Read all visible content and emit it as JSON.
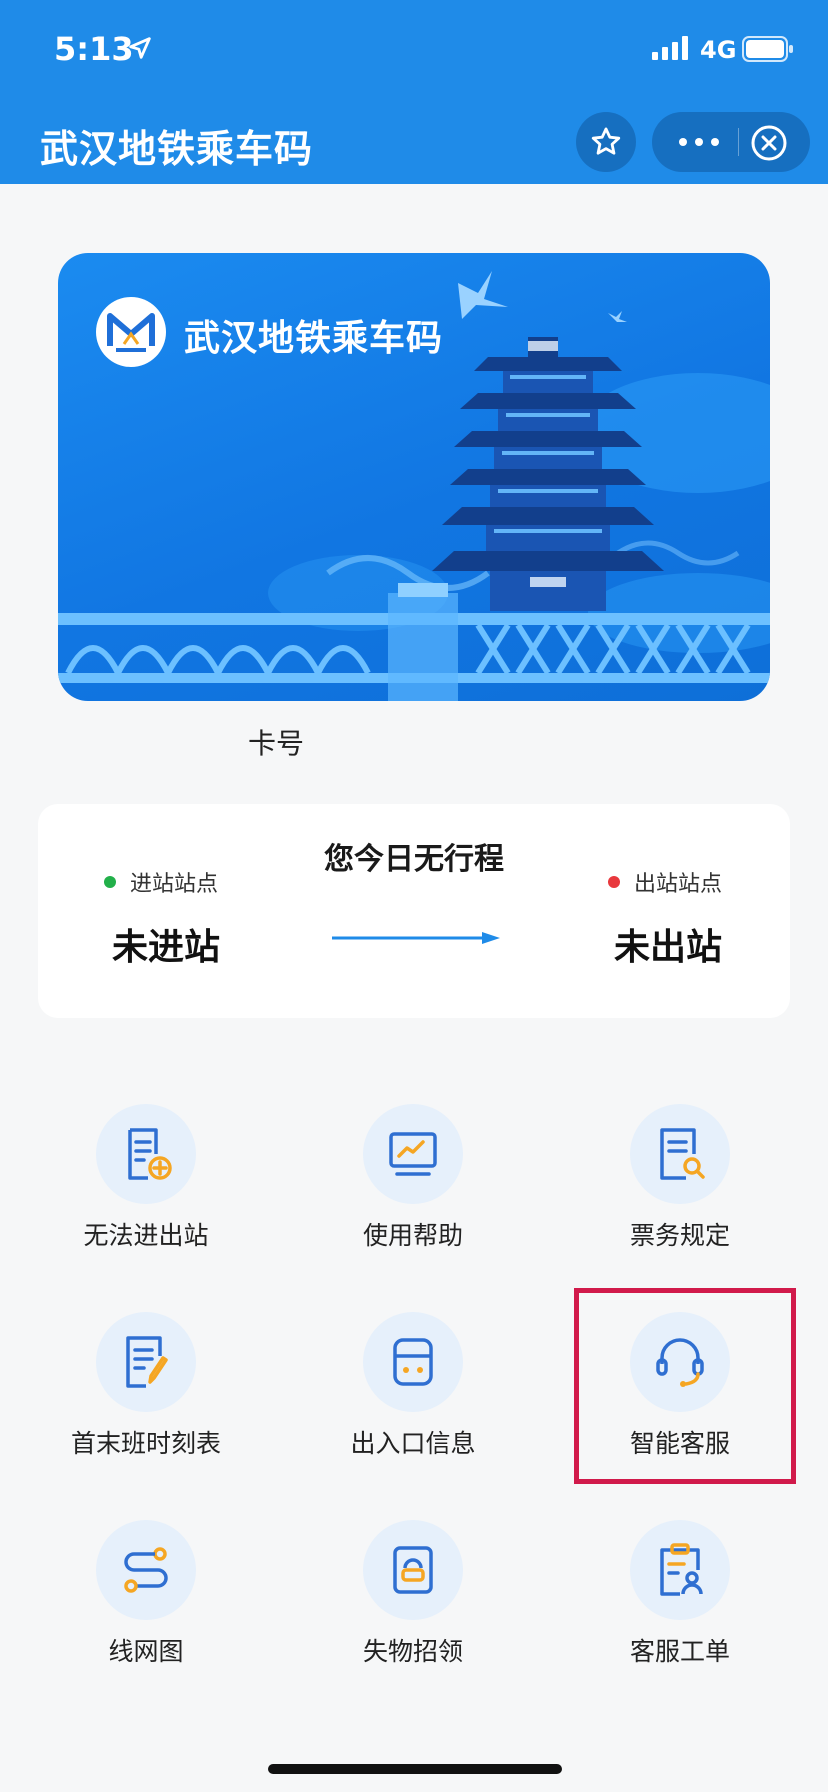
{
  "status_bar": {
    "time": "5:13",
    "network": "4G"
  },
  "nav": {
    "title": "武汉地铁乘车码",
    "favorite_icon": "star-icon",
    "more_icon": "more-dots-icon",
    "close_icon": "close-circle-icon"
  },
  "card": {
    "title": "武汉地铁乘车码",
    "logo": "metro-logo",
    "card_number_label": "卡号"
  },
  "trip": {
    "status": "您今日无行程",
    "entry_label": "进站站点",
    "entry_value": "未进站",
    "exit_label": "出站站点",
    "exit_value": "未出站"
  },
  "menu": [
    {
      "label": "无法进出站",
      "icon": "document-add-icon"
    },
    {
      "label": "使用帮助",
      "icon": "monitor-chart-icon"
    },
    {
      "label": "票务规定",
      "icon": "document-search-icon"
    },
    {
      "label": "首末班时刻表",
      "icon": "document-edit-icon"
    },
    {
      "label": "出入口信息",
      "icon": "gate-icon"
    },
    {
      "label": "智能客服",
      "icon": "headset-icon"
    },
    {
      "label": "线网图",
      "icon": "route-icon"
    },
    {
      "label": "失物招领",
      "icon": "lost-found-icon"
    },
    {
      "label": "客服工单",
      "icon": "clipboard-user-icon"
    }
  ],
  "colors": {
    "primary": "#1f8be8",
    "icon_blue": "#2f6fd1",
    "icon_orange": "#f5a623",
    "highlight": "#d11a4b"
  }
}
